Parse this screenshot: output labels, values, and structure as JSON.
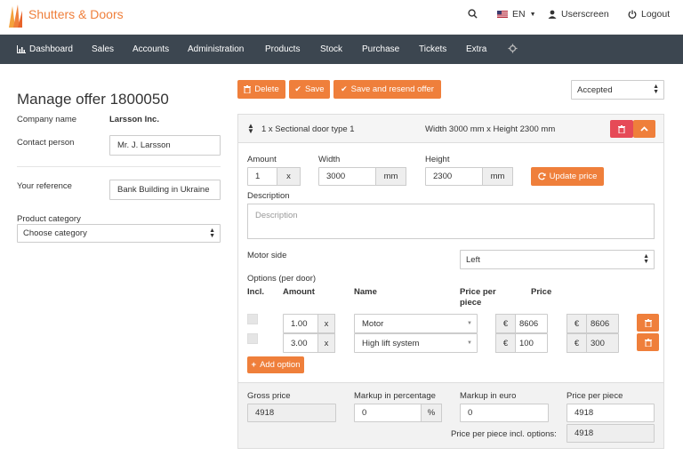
{
  "header": {
    "brand": "Shutters & Doors",
    "language": "EN",
    "user": "Userscreen",
    "logout": "Logout"
  },
  "nav": {
    "items": [
      "Dashboard",
      "Sales",
      "Accounts",
      "Administration",
      "Products",
      "Stock",
      "Purchase",
      "Tickets",
      "Extra"
    ]
  },
  "offer": {
    "title": "Manage offer 1800050",
    "company_label": "Company name",
    "company_value": "Larsson Inc.",
    "contact_label": "Contact person",
    "contact_value": "Mr. J. Larsson",
    "reference_label": "Your reference",
    "reference_value": "Bank Building in Ukraine",
    "category_label": "Product category",
    "category_value": "Choose category"
  },
  "toolbar": {
    "delete": "Delete",
    "save": "Save",
    "save_resend": "Save and resend offer",
    "status_value": "Accepted"
  },
  "product": {
    "header_title": "1 x Sectional door type 1",
    "header_dims": "Width 3000 mm x Height 2300 mm",
    "amount_label": "Amount",
    "amount_value": "1",
    "amount_unit": "x",
    "width_label": "Width",
    "width_value": "3000",
    "width_unit": "mm",
    "height_label": "Height",
    "height_value": "2300",
    "height_unit": "mm",
    "update_price": "Update price",
    "description_label": "Description",
    "description_placeholder": "Description",
    "motor_label": "Motor side",
    "motor_value": "Left",
    "options_label": "Options (per door)",
    "col_incl": "Incl.",
    "col_amount": "Amount",
    "col_name": "Name",
    "col_ppp": "Price per piece",
    "col_price": "Price",
    "currency": "€",
    "options": [
      {
        "amount": "1.00",
        "unit": "x",
        "name": "Motor",
        "ppp": "8606",
        "price": "8606"
      },
      {
        "amount": "3.00",
        "unit": "x",
        "name": "High lift system",
        "ppp": "100",
        "price": "300"
      }
    ],
    "add_option": "Add option"
  },
  "totals": {
    "gross_label": "Gross price",
    "gross_value": "4918",
    "markup_pct_label": "Markup in percentage",
    "markup_pct_value": "0",
    "markup_pct_unit": "%",
    "markup_eur_label": "Markup in euro",
    "markup_eur_value": "0",
    "ppp_label": "Price per piece",
    "ppp_value": "4918",
    "ppp_incl_label": "Price per piece incl. options:",
    "ppp_incl_value": "4918"
  },
  "colors": {
    "brand": "#ef7f3b",
    "nav_bg": "#3c4650",
    "danger": "#e64a57"
  }
}
